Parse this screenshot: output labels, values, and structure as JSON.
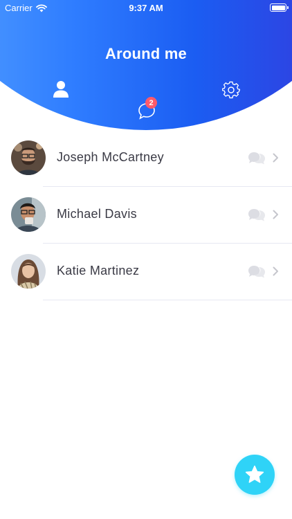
{
  "status_bar": {
    "carrier": "Carrier",
    "time": "9:37 AM"
  },
  "header": {
    "title": "Around me",
    "chat_badge_count": "2",
    "icons": [
      "user-icon",
      "chat-icon",
      "settings-icon"
    ]
  },
  "contacts": [
    {
      "name": "Joseph McCartney"
    },
    {
      "name": "Michael Davis"
    },
    {
      "name": "Katie Martinez"
    }
  ],
  "colors": {
    "gradient_start": "#5aa6ff",
    "gradient_end": "#3d2fd6",
    "badge": "#ff5a6b",
    "fab": "#2fd3f7",
    "text": "#3a3a45"
  },
  "fab": {
    "icon": "star-icon"
  }
}
